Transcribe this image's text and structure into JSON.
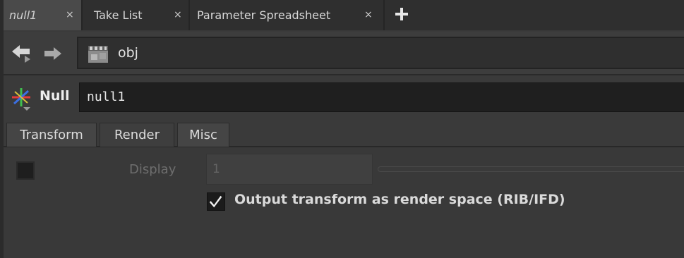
{
  "tabs": [
    {
      "label": "null1",
      "active": true
    },
    {
      "label": "Take List",
      "active": false
    },
    {
      "label": "Parameter Spreadsheet",
      "active": false
    }
  ],
  "tab_close_glyph": "×",
  "path": {
    "current": "obj"
  },
  "node": {
    "type_label": "Null",
    "name": "null1"
  },
  "param_tabs": [
    "Transform",
    "Render",
    "Misc"
  ],
  "params": {
    "display": {
      "label": "Display",
      "value": "1",
      "enabled": false,
      "checked": false
    },
    "output_transform": {
      "label": "Output transform as render space (RIB/IFD)",
      "checked": true
    }
  },
  "icons": {
    "add_tab": "plus-icon",
    "back": "arrow-back-icon",
    "forward": "arrow-forward-icon",
    "path_root": "obj-network-icon",
    "node_type": "null-node-icon",
    "check": "checkmark-icon"
  },
  "colors": {
    "background": "#3a3a3a",
    "field": "#1f1f1f",
    "active_tab": "#4a4a4a"
  }
}
